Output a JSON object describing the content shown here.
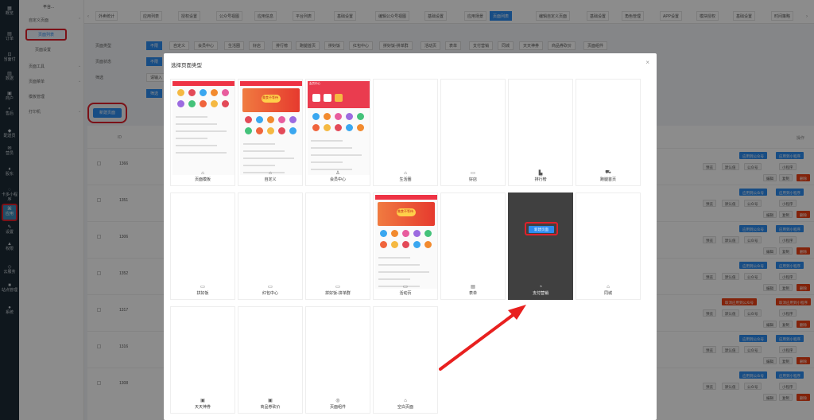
{
  "nav": {
    "brand": "平台...",
    "items": [
      {
        "icon": "▦",
        "label": "概览"
      },
      {
        "icon": "▤",
        "label": "订单"
      },
      {
        "icon": "⊡",
        "label": "当面付"
      },
      {
        "icon": "▥",
        "label": "数据"
      },
      {
        "icon": "▣",
        "label": "商户"
      },
      {
        "icon": "◐",
        "label": "售后"
      },
      {
        "icon": "◆",
        "label": "配送员"
      },
      {
        "icon": "✉",
        "label": "营员"
      },
      {
        "icon": "♦",
        "label": "股东"
      },
      {
        "icon": "◌",
        "label": "卡多小程序"
      },
      {
        "icon": "⌘",
        "label": "应用"
      },
      {
        "icon": "✎",
        "label": "设置"
      },
      {
        "icon": "▲",
        "label": "权限"
      },
      {
        "icon": "◇",
        "label": "云服务"
      },
      {
        "icon": "■",
        "label": "站点管理"
      },
      {
        "icon": "●",
        "label": "系统"
      }
    ]
  },
  "subnav": {
    "items": [
      "自定义页面",
      "页面列表",
      "页面设置",
      "页面工具",
      "页面菜单",
      "模板管理",
      "打印机"
    ]
  },
  "tabs": [
    "外卖统计",
    "应用列表",
    "授权设置",
    "公众号视图",
    "应用信息",
    "平台列表",
    "基础设置",
    "编辑公众号视图",
    "基础设置",
    "应用场景",
    "页面列表",
    "编辑自定义页面",
    "基础设置",
    "角色管理",
    "APP设置",
    "模块授权",
    "基础设置",
    "时间策略"
  ],
  "filters": {
    "labels": [
      "页面类型",
      "页面状态",
      "筛选"
    ],
    "types": [
      "不限",
      "自定义",
      "会员中心",
      "生活圈",
      "好店",
      "排行榜",
      "跑腿首页",
      "拼好饭",
      "红包中心",
      "拼好饭-拼单群",
      "活动页",
      "表单",
      "支付营销",
      "同城",
      "天天神券",
      "商品券砍价",
      "页面组件"
    ],
    "status": [
      "不限"
    ],
    "search_placeholder": "请输入",
    "search_btn": "筛选",
    "new_page": "新建页面"
  },
  "table": {
    "headers": {
      "id": "ID",
      "ops": "操作"
    },
    "rows": [
      {
        "id": "1366"
      },
      {
        "id": "1351"
      },
      {
        "id": "1306"
      },
      {
        "id": "1352"
      },
      {
        "id": "1317"
      },
      {
        "id": "1316"
      },
      {
        "id": "1308"
      }
    ],
    "btn_apply_mp": "应用到公众号",
    "btn_apply_mini": "应用到小程序",
    "btn_cancel_mp": "取消应用到公众号",
    "btn_cancel_mini": "取消应用到小程序",
    "btn_preview": "预览",
    "btn_default": "默认值",
    "btn_mp": "公众号",
    "btn_mini": "小程序",
    "btn_edit": "编辑",
    "btn_copy": "复制",
    "btn_delete": "删除"
  },
  "modal": {
    "title": "选择页面类型",
    "close": "×",
    "cards": [
      {
        "label": "页面模板",
        "icon": "⌂"
      },
      {
        "label": "自定义",
        "icon": "⌂"
      },
      {
        "label": "会员中心",
        "icon": "♙"
      },
      {
        "label": "生活圈",
        "icon": "⌂"
      },
      {
        "label": "好店",
        "icon": "▭"
      },
      {
        "label": "排行榜",
        "icon": "▙"
      },
      {
        "label": "跑腿首页",
        "icon": "⛟"
      },
      {
        "label": "拼好饭",
        "icon": "▭"
      },
      {
        "label": "红包中心",
        "icon": "▭"
      },
      {
        "label": "拼好饭-拼单群",
        "icon": "▭"
      },
      {
        "label": "活动页",
        "icon": "▭"
      },
      {
        "label": "表单",
        "icon": "▤"
      },
      {
        "label": "支付营销",
        "icon": "◔"
      },
      {
        "label": "同城",
        "icon": "⌂"
      },
      {
        "label": "天天神券",
        "icon": "▣"
      },
      {
        "label": "商品券砍价",
        "icon": "▣"
      },
      {
        "label": "页面组件",
        "icon": "◎"
      },
      {
        "label": "空白页面",
        "icon": "⌂"
      }
    ],
    "create_btn": "新建页面",
    "thumb_member_title": "会员中心",
    "thumb_banner_text": "美食不等待"
  },
  "colors": {
    "accent": "#2d8cf0",
    "highlight": "#e0202a",
    "danger": "#ed4014",
    "sidebar": "#1c2b36"
  }
}
